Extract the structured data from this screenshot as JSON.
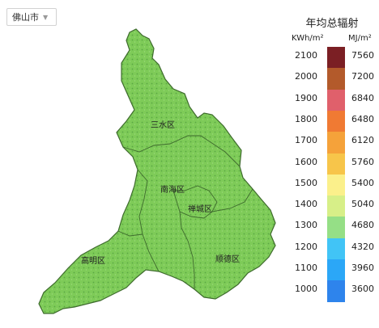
{
  "city_select": {
    "value": "佛山市"
  },
  "map": {
    "regions": [
      {
        "name": "三水区"
      },
      {
        "name": "南海区"
      },
      {
        "name": "禅城区"
      },
      {
        "name": "高明区"
      },
      {
        "name": "顺德区"
      }
    ],
    "fill_color": "#7ecb58",
    "border_color": "#3e6b2d"
  },
  "legend": {
    "title": "年均总辐射",
    "unit_left": "KWh/m²",
    "unit_right": "MJ/m²",
    "classes": [
      {
        "kwh": "2100",
        "mj": "7560",
        "color": "#7b1f24"
      },
      {
        "kwh": "2000",
        "mj": "7200",
        "color": "#b35a2b"
      },
      {
        "kwh": "1900",
        "mj": "6840",
        "color": "#e0606b"
      },
      {
        "kwh": "1800",
        "mj": "6480",
        "color": "#f07a33"
      },
      {
        "kwh": "1700",
        "mj": "6120",
        "color": "#f5a23a"
      },
      {
        "kwh": "1600",
        "mj": "5760",
        "color": "#f7c54a"
      },
      {
        "kwh": "1500",
        "mj": "5400",
        "color": "#fbf08b"
      },
      {
        "kwh": "1400",
        "mj": "5040",
        "color": "#d7ef88"
      },
      {
        "kwh": "1300",
        "mj": "4680",
        "color": "#95df86"
      },
      {
        "kwh": "1200",
        "mj": "4320",
        "color": "#41c4f6"
      },
      {
        "kwh": "1100",
        "mj": "3960",
        "color": "#2ba7f7"
      },
      {
        "kwh": "1000",
        "mj": "3600",
        "color": "#2e84ec"
      }
    ]
  }
}
